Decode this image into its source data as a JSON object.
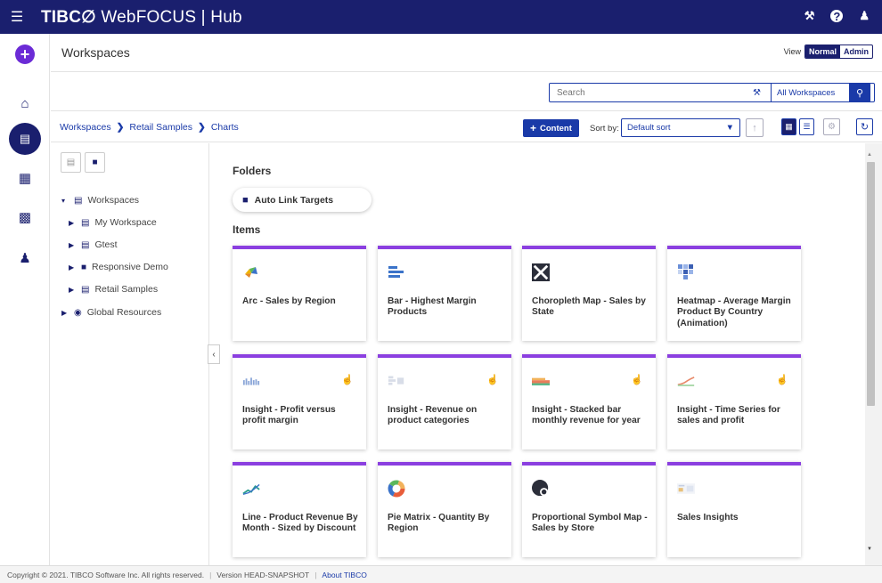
{
  "topbar": {
    "menu_icon": "hamburger-icon",
    "brand_tibco": "TIBC∅",
    "brand_rest": " WebFOCUS",
    "brand_sep": " | ",
    "brand_hub": "Hub",
    "right_icons": [
      "tools-icon",
      "help-icon",
      "user-icon"
    ],
    "help_glyph": "?"
  },
  "leftrail": {
    "items": [
      "create-plus-icon",
      "home-icon",
      "workspaces-icon",
      "portals-icon",
      "reports-icon",
      "admin-users-icon"
    ]
  },
  "header": {
    "title": "Workspaces",
    "view_label": "View",
    "view_normal": "Normal",
    "view_admin": "Admin"
  },
  "search": {
    "placeholder": "Search",
    "scope": "All Workspaces"
  },
  "breadcrumb": {
    "items": [
      "Workspaces",
      "Retail Samples",
      "Charts"
    ],
    "sep": "❯"
  },
  "toolbar": {
    "content_label": "Content",
    "content_plus": "+",
    "sort_label": "Sort by:",
    "sort_value": "Default sort"
  },
  "tree": {
    "root": "Workspaces",
    "children": [
      "My Workspace",
      "Gtest",
      "Responsive Demo",
      "Retail Samples"
    ],
    "global": "Global Resources"
  },
  "main": {
    "folders_title": "Folders",
    "folders": [
      "Auto Link Targets"
    ],
    "items_title": "Items",
    "items": [
      {
        "label": "Arc - Sales by Region",
        "icon": "arc-chart-icon",
        "touch": false
      },
      {
        "label": "Bar - Highest Margin Products",
        "icon": "bar-chart-icon",
        "touch": false
      },
      {
        "label": "Choropleth Map - Sales by State",
        "icon": "map-icon",
        "touch": false
      },
      {
        "label": "Heatmap - Average Margin Product By Country (Animation)",
        "icon": "heatmap-icon",
        "touch": false
      },
      {
        "label": "Insight - Profit versus profit margin",
        "icon": "insight-icon",
        "touch": true
      },
      {
        "label": "Insight - Revenue on product categories",
        "icon": "insight-icon",
        "touch": true
      },
      {
        "label": "Insight - Stacked bar monthly revenue for year",
        "icon": "insight-icon",
        "touch": true
      },
      {
        "label": "Insight - Time Series for sales and profit",
        "icon": "insight-icon",
        "touch": true
      },
      {
        "label": "Line - Product Revenue By Month - Sized by Discount",
        "icon": "line-chart-icon",
        "touch": false
      },
      {
        "label": "Pie Matrix - Quantity By Region",
        "icon": "pie-chart-icon",
        "touch": false
      },
      {
        "label": "Proportional Symbol Map - Sales by Store",
        "icon": "symbol-map-icon",
        "touch": false
      },
      {
        "label": "Sales Insights",
        "icon": "insight-icon",
        "touch": false
      }
    ]
  },
  "footer": {
    "copyright": "Copyright © 2021. TIBCO Software Inc. All rights reserved.",
    "sep": "|",
    "version": "Version HEAD-SNAPSHOT",
    "about": "About TIBCO"
  },
  "colors": {
    "topbar": "#1a1f6e",
    "accent": "#1a3aa8",
    "card_top": "#8b3fe0",
    "create": "#6b2bd6"
  }
}
